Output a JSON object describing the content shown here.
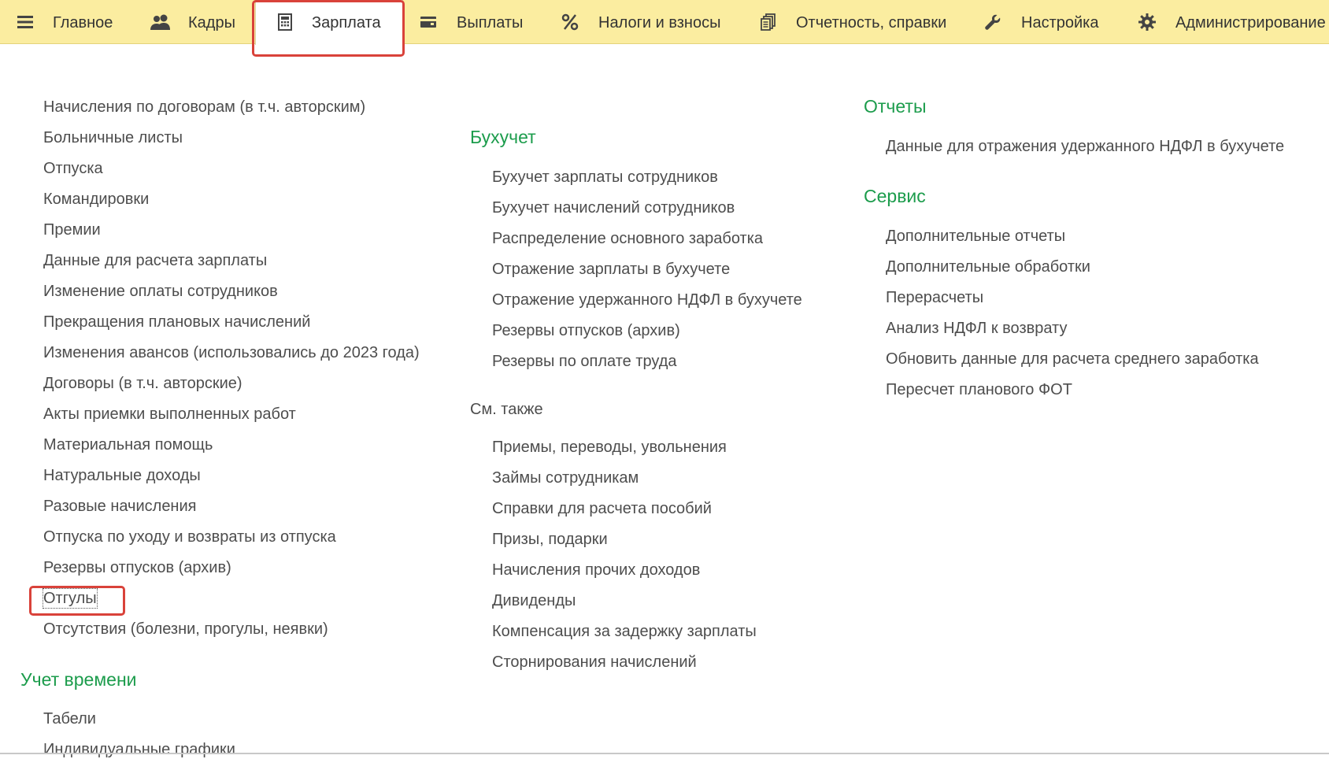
{
  "nav": {
    "menu_icon": "hamburger-icon",
    "items": [
      {
        "label": "Главное",
        "icon": "hamburger-icon"
      },
      {
        "label": "Кадры",
        "icon": "users-icon"
      },
      {
        "label": "Зарплата",
        "icon": "calculator-icon",
        "active": true
      },
      {
        "label": "Выплаты",
        "icon": "wallet-icon"
      },
      {
        "label": "Налоги и взносы",
        "icon": "percent-icon"
      },
      {
        "label": "Отчетность, справки",
        "icon": "documents-icon"
      },
      {
        "label": "Настройка",
        "icon": "wrench-icon"
      },
      {
        "label": "Администрирование",
        "icon": "gear-icon"
      }
    ]
  },
  "col1": {
    "items": [
      "Начисления по договорам (в т.ч. авторским)",
      "Больничные листы",
      "Отпуска",
      "Командировки",
      "Премии",
      "Данные для расчета зарплаты",
      "Изменение оплаты сотрудников",
      "Прекращения плановых начислений",
      "Изменения авансов (использовались до 2023 года)",
      "Договоры (в т.ч. авторские)",
      "Акты приемки выполненных работ",
      "Материальная помощь",
      "Натуральные доходы",
      "Разовые начисления",
      "Отпуска по уходу и возвраты из отпуска",
      "Резервы отпусков (архив)",
      "Отгулы",
      "Отсутствия (болезни, прогулы, неявки)"
    ],
    "time_section": "Учет времени",
    "time_items": [
      "Табели",
      "Индивидуальные графики"
    ]
  },
  "col2": {
    "section": "Бухучет",
    "items": [
      "Бухучет зарплаты сотрудников",
      "Бухучет начислений сотрудников",
      "Распределение основного заработка",
      "Отражение зарплаты в бухучете",
      "Отражение удержанного НДФЛ в бухучете",
      "Резервы отпусков (архив)",
      "Резервы по оплате труда"
    ],
    "see_also": "См. также",
    "see_also_items": [
      "Приемы, переводы, увольнения",
      "Займы сотрудникам",
      "Справки для расчета пособий",
      "Призы, подарки",
      "Начисления прочих доходов",
      "Дивиденды",
      "Компенсация за задержку зарплаты",
      "Сторнирования начислений"
    ]
  },
  "col3": {
    "reports_section": "Отчеты",
    "reports_items": [
      "Данные для отражения удержанного НДФЛ в бухучете"
    ],
    "service_section": "Сервис",
    "service_items": [
      "Дополнительные отчеты",
      "Дополнительные обработки",
      "Перерасчеты",
      "Анализ НДФЛ к возврату",
      "Обновить данные для расчета среднего заработка",
      "Пересчет планового ФОТ"
    ]
  },
  "colors": {
    "topbar": "#fbeda0",
    "section_green": "#1c9c4c",
    "highlight_red": "#d9423a",
    "text": "#4d4d4d"
  }
}
